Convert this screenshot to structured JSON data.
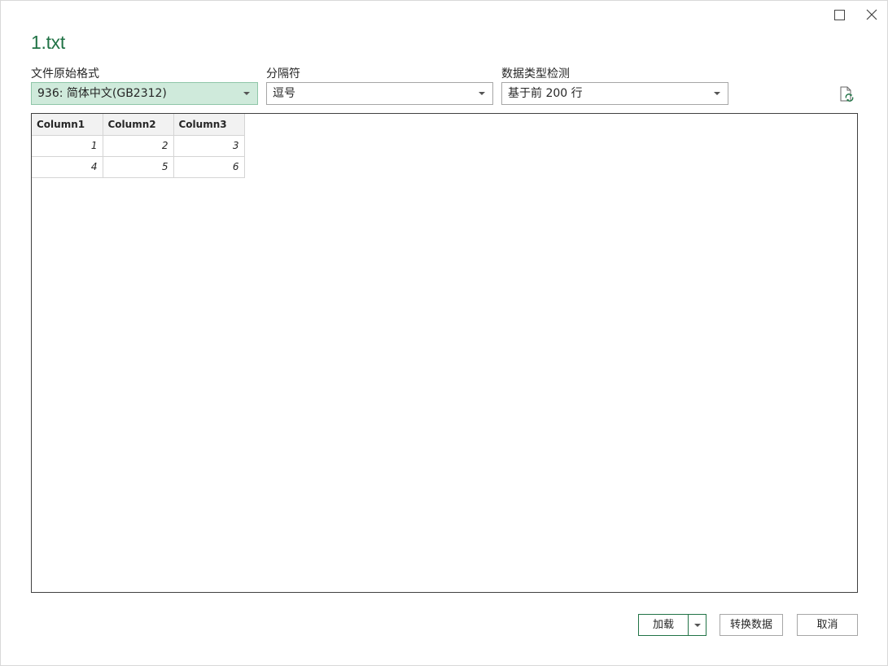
{
  "window": {
    "title": "1.txt"
  },
  "options": {
    "encoding": {
      "label": "文件原始格式",
      "value": "936: 简体中文(GB2312)"
    },
    "delimiter": {
      "label": "分隔符",
      "value": "逗号"
    },
    "type_detection": {
      "label": "数据类型检测",
      "value": "基于前 200 行"
    }
  },
  "preview": {
    "columns": [
      "Column1",
      "Column2",
      "Column3"
    ],
    "rows": [
      [
        "1",
        "2",
        "3"
      ],
      [
        "4",
        "5",
        "6"
      ]
    ]
  },
  "buttons": {
    "load": "加载",
    "transform": "转换数据",
    "cancel": "取消"
  },
  "colors": {
    "accent": "#217346",
    "selected_field_bg": "#cfeadb"
  },
  "icons": {
    "maximize": "maximize-icon",
    "close": "close-icon",
    "refresh": "refresh-file-icon",
    "dropdown": "chevron-down-icon"
  }
}
